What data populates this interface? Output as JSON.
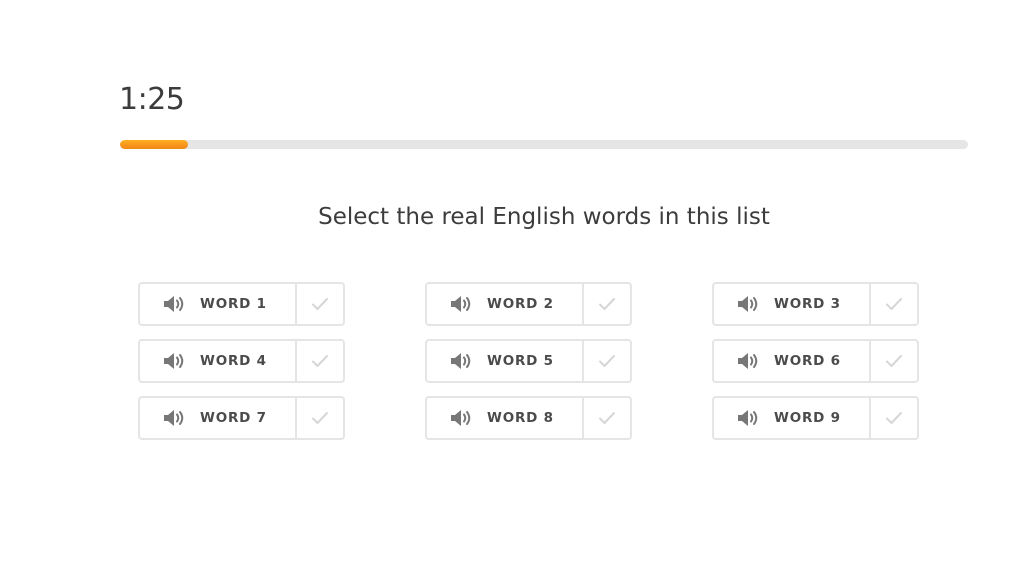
{
  "timer": {
    "text": "1:25"
  },
  "progress": {
    "fraction": 0.08,
    "color": "#f7941d"
  },
  "prompt": "Select the real English words in this list",
  "icons": {
    "audio": "speaker-icon",
    "select": "check-icon"
  },
  "words": [
    {
      "label": "WORD 1"
    },
    {
      "label": "WORD 2"
    },
    {
      "label": "WORD 3"
    },
    {
      "label": "WORD 4"
    },
    {
      "label": "WORD 5"
    },
    {
      "label": "WORD 6"
    },
    {
      "label": "WORD 7"
    },
    {
      "label": "WORD 8"
    },
    {
      "label": "WORD 9"
    }
  ]
}
